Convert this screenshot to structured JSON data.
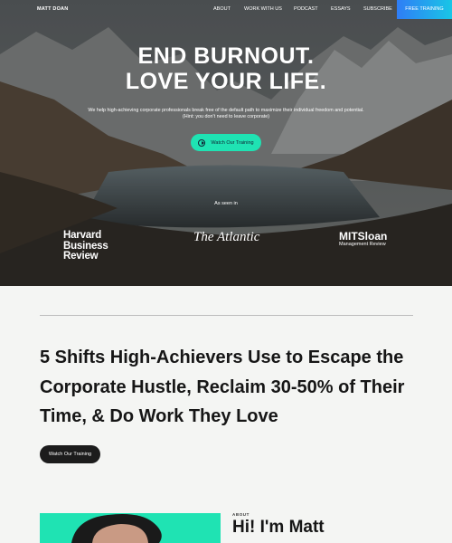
{
  "nav": {
    "brand": "MATT DOAN",
    "links": [
      "ABOUT",
      "WORK WITH US",
      "PODCAST",
      "ESSAYS",
      "SUBSCRIBE"
    ],
    "cta": "FREE TRAINING",
    "cta_colors": [
      "#2f7df6",
      "#19c6e6"
    ]
  },
  "hero": {
    "headline_line1": "END BURNOUT.",
    "headline_line2": "LOVE YOUR LIFE.",
    "sub_line1": "We help high-achieving corporate professionals break free of the default path to maximize their individual freedom and potential.",
    "sub_line2": "(Hint: you don't need to leave corporate)",
    "watch_label": "Watch Our Training",
    "accent": "#1fe3b3",
    "seen_label": "As seen in",
    "logos": {
      "hbr": [
        "Harvard",
        "Business",
        "Review"
      ],
      "atlantic": "The Atlantic",
      "mit_main": "MITSloan",
      "mit_sub": "Management Review"
    }
  },
  "section": {
    "title": "5 Shifts High-Achievers Use to Escape the Corporate Hustle, Reclaim 30-50% of Their Time, & Do Work They Love",
    "watch_label": "Watch Our Training"
  },
  "about": {
    "label": "ABOUT",
    "title": "Hi! I'm Matt"
  }
}
